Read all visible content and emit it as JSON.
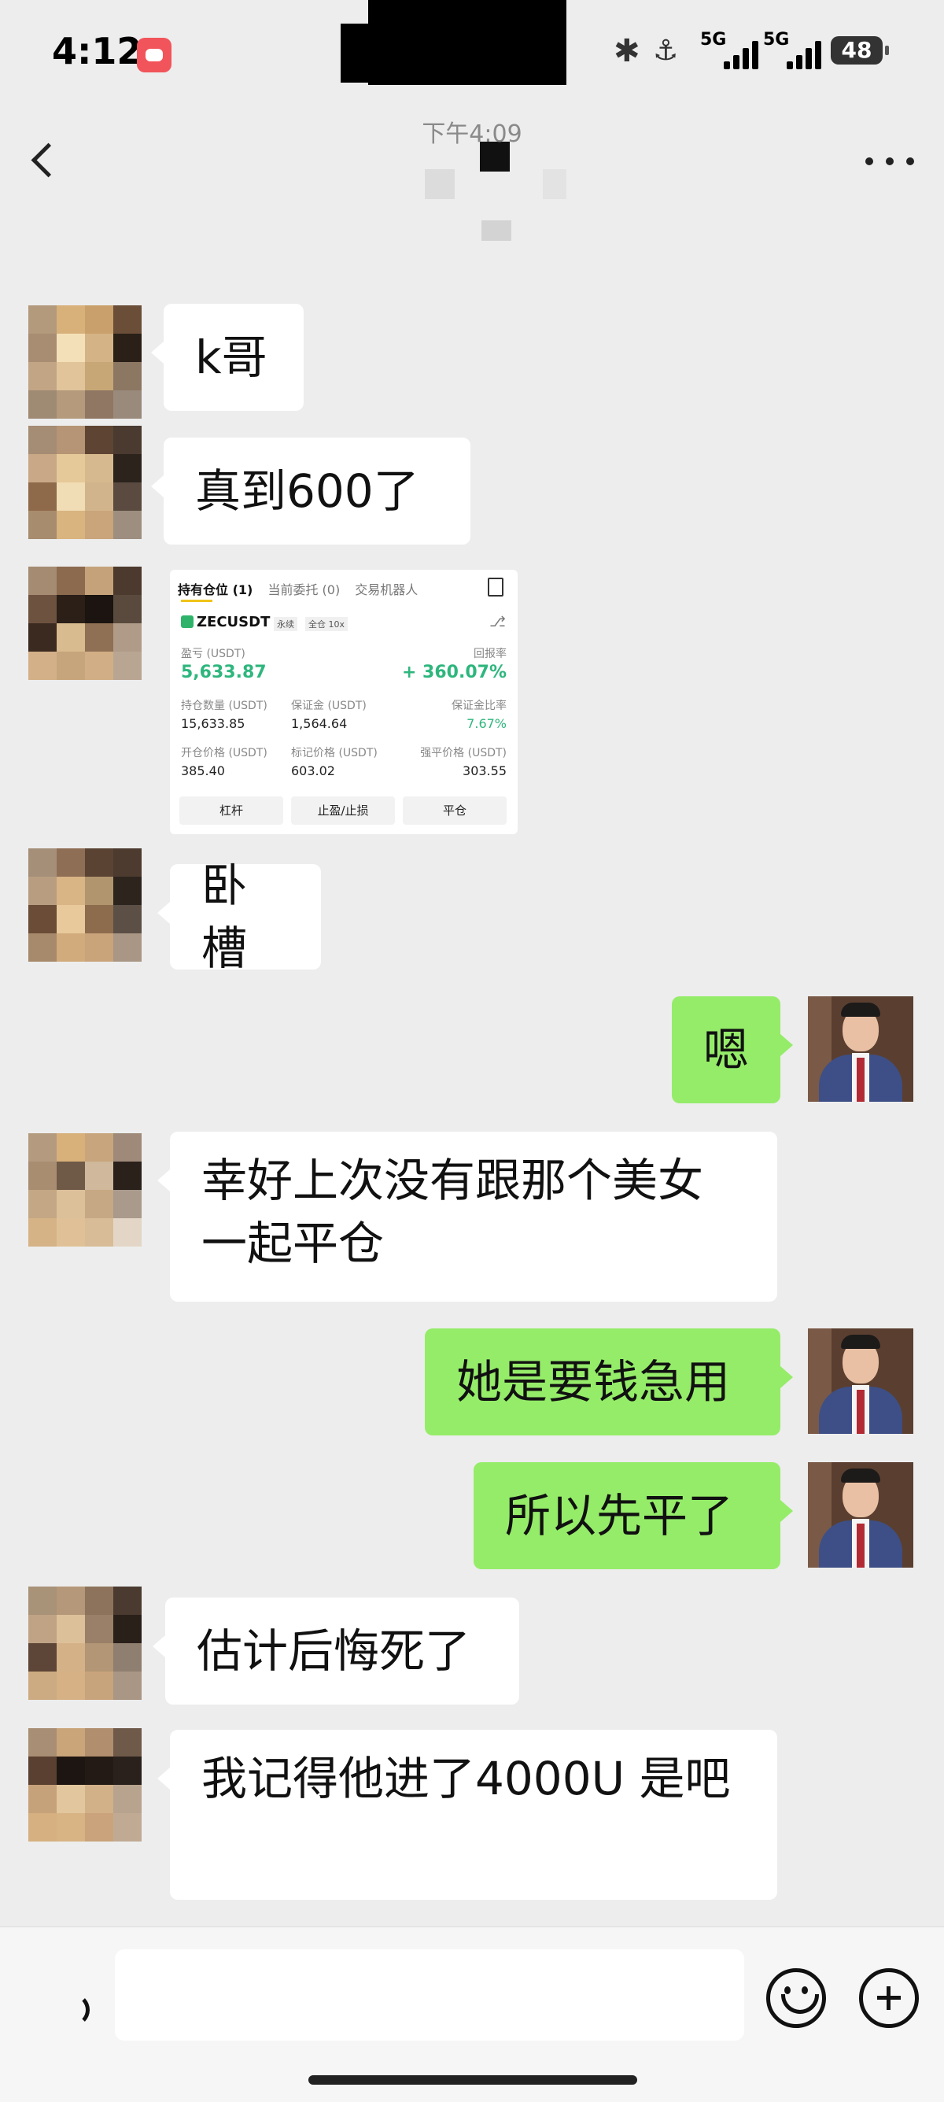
{
  "status_bar": {
    "time": "4:12",
    "net1": "5G",
    "net2": "5G",
    "battery": "48"
  },
  "chat": {
    "timestamp": "下午4:09",
    "messages": [
      {
        "side": "in",
        "text": "k哥"
      },
      {
        "side": "in",
        "text": "真到600了"
      },
      {
        "side": "in",
        "type": "image"
      },
      {
        "side": "in",
        "text": "卧槽"
      },
      {
        "side": "out",
        "text": "嗯"
      },
      {
        "side": "in",
        "text": "幸好上次没有跟那个美女一起平仓"
      },
      {
        "side": "out",
        "text": "她是要钱急用"
      },
      {
        "side": "out",
        "text": "所以先平了"
      },
      {
        "side": "in",
        "text": "估计后悔死了"
      },
      {
        "side": "in",
        "text": "我记得他进了4000U 是吧"
      }
    ]
  },
  "trade_card": {
    "tab_positions": "持有仓位 (1)",
    "tab_orders": "当前委托 (0)",
    "tab_bots": "交易机器人",
    "symbol": "ZECUSDT",
    "tag_perp": "永续",
    "tag_cross": "全仓 10x",
    "pnl_label": "盈亏 (USDT)",
    "pnl_value": "5,633.87",
    "roe_label": "回报率",
    "roe_value": "+ 360.07%",
    "qty_label": "持仓数量 (USDT)",
    "qty_value": "15,633.85",
    "margin_label": "保证金 (USDT)",
    "margin_value": "1,564.64",
    "ratio_label": "保证金比率",
    "ratio_value": "7.67%",
    "open_label": "开仓价格 (USDT)",
    "open_value": "385.40",
    "mark_label": "标记价格 (USDT)",
    "mark_value": "603.02",
    "liq_label": "强平价格 (USDT)",
    "liq_value": "303.55",
    "btn_leverage": "杠杆",
    "btn_tpsl": "止盈/止损",
    "btn_close": "平仓"
  },
  "colors": {
    "bubble_out": "#95ec69",
    "bubble_in": "#ffffff",
    "background": "#ededed",
    "profit_green": "#2eb67d"
  }
}
